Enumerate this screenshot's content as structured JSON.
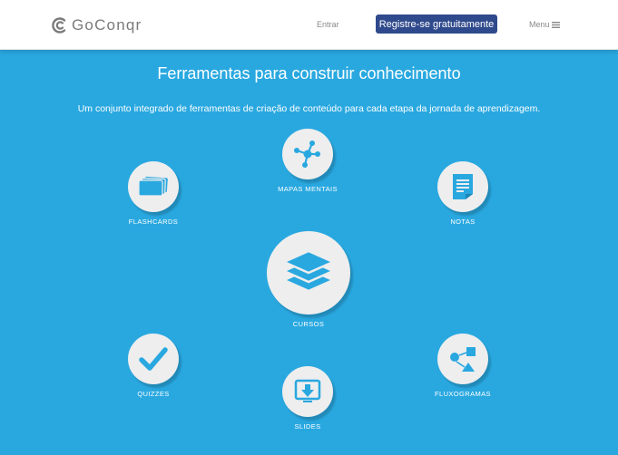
{
  "header": {
    "logo_text": "GoConqr",
    "signin": "Entrar",
    "register": "Registre-se gratuitamente",
    "menu": "Menu"
  },
  "hero": {
    "title": "Ferramentas para construir conhecimento",
    "subtitle": "Um conjunto integrado de ferramentas de criação de conteúdo para cada etapa da jornada de aprendizagem."
  },
  "tools": {
    "mind_maps": "MAPAS MENTAIS",
    "flashcards": "FLASHCARDS",
    "notes": "NOTAS",
    "courses": "CURSOS",
    "quizzes": "QUIZZES",
    "flowcharts": "FLUXOGRAMAS",
    "slides": "SLIDES"
  },
  "colors": {
    "background": "#29a8e0",
    "icon_blue": "#29a8e0",
    "button": "#2f4a8c",
    "circle": "#eeeeee"
  }
}
